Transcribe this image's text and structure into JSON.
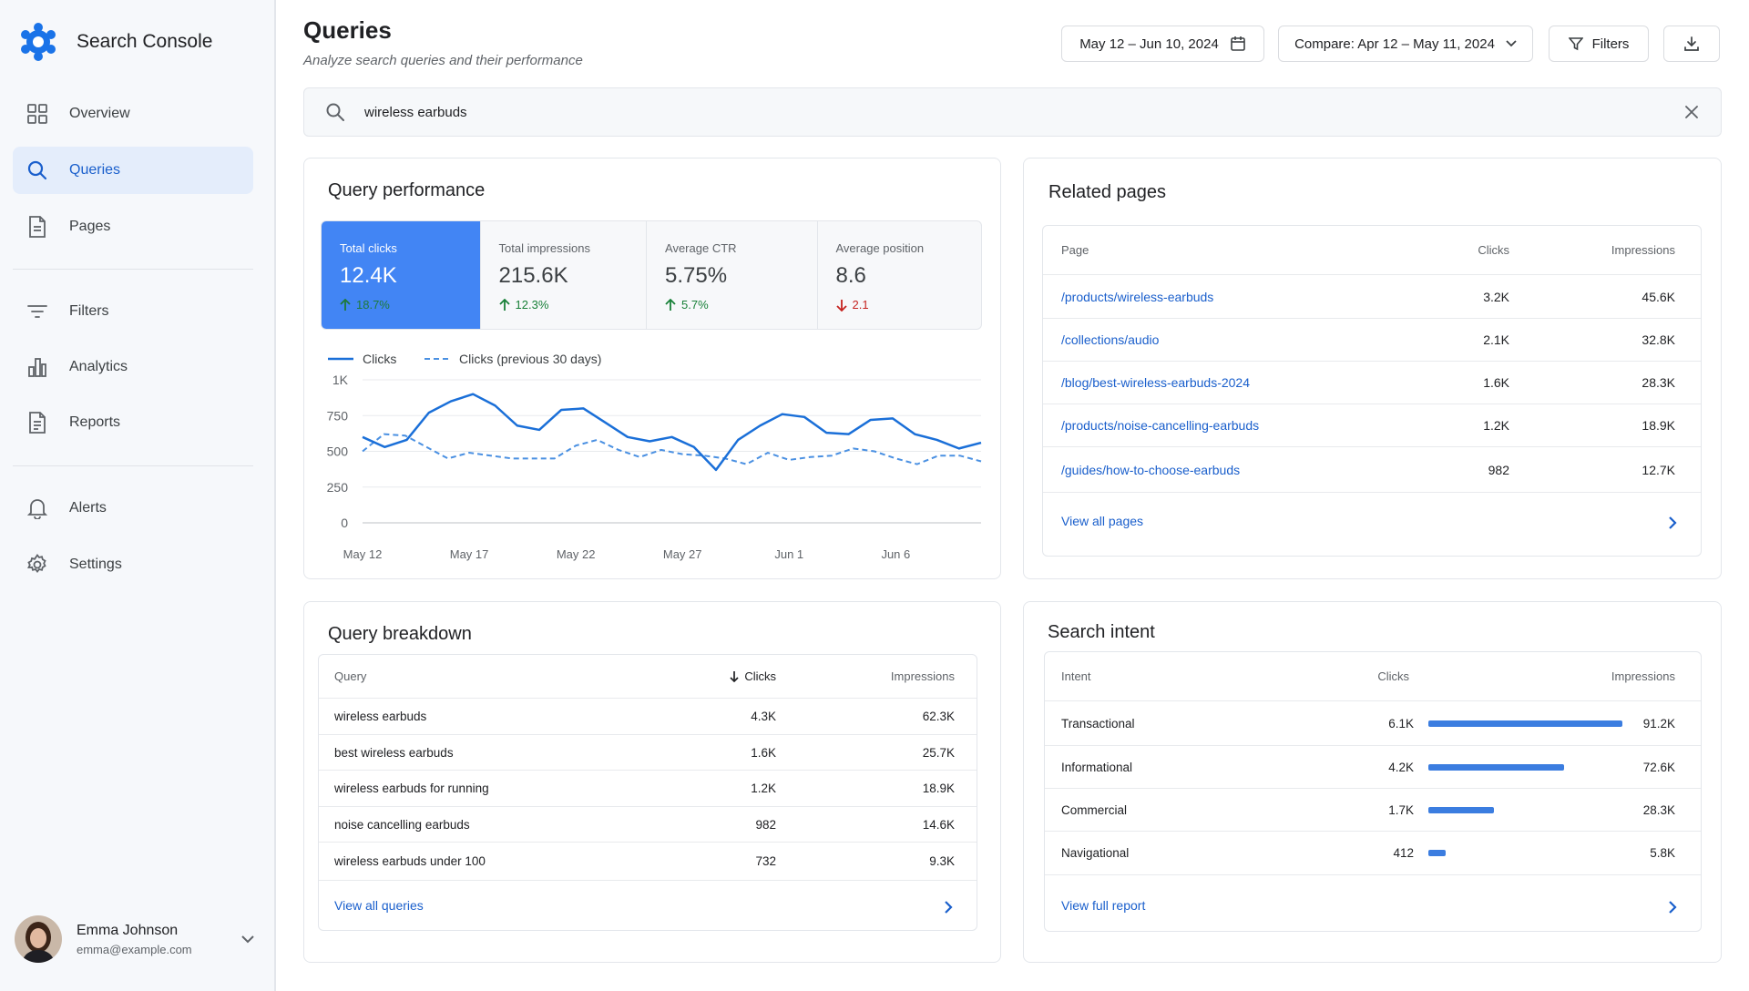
{
  "app": {
    "name": "Search Console"
  },
  "sidebar": {
    "items": [
      {
        "label": "Overview",
        "icon": "grid-icon"
      },
      {
        "label": "Queries",
        "icon": "search-icon",
        "active": true
      },
      {
        "label": "Pages",
        "icon": "document-icon"
      },
      {
        "label": "Filters",
        "icon": "filter-lines-icon"
      },
      {
        "label": "Analytics",
        "icon": "bar-chart-icon"
      },
      {
        "label": "Reports",
        "icon": "report-icon"
      },
      {
        "label": "Alerts",
        "icon": "bell-icon"
      },
      {
        "label": "Settings",
        "icon": "gear-icon"
      }
    ]
  },
  "user": {
    "name": "Emma Johnson",
    "email": "emma@example.com"
  },
  "header": {
    "title": "Queries",
    "subtitle": "Analyze search queries and their performance",
    "date_range": "May 12 – Jun 10, 2024",
    "compare": "Compare: Apr 12 – May 11, 2024",
    "filters_label": "Filters"
  },
  "search": {
    "value": "wireless earbuds"
  },
  "performance": {
    "title": "Query performance",
    "metrics": [
      {
        "label": "Total clicks",
        "value": "12.4K",
        "delta": "18.7%",
        "direction": "up",
        "active": true
      },
      {
        "label": "Total impressions",
        "value": "215.6K",
        "delta": "12.3%",
        "direction": "up"
      },
      {
        "label": "Average CTR",
        "value": "5.75%",
        "delta": "5.7%",
        "direction": "up"
      },
      {
        "label": "Average position",
        "value": "8.6",
        "delta": "2.1",
        "direction": "down"
      }
    ]
  },
  "chart_data": {
    "type": "line",
    "x": [
      "May 12",
      "May 13",
      "May 14",
      "May 15",
      "May 16",
      "May 17",
      "May 18",
      "May 19",
      "May 20",
      "May 21",
      "May 22",
      "May 23",
      "May 24",
      "May 25",
      "May 26",
      "May 27",
      "May 28",
      "May 29",
      "May 30",
      "May 31",
      "Jun 1",
      "Jun 2",
      "Jun 3",
      "Jun 4",
      "Jun 5",
      "Jun 6",
      "Jun 7",
      "Jun 8",
      "Jun 9",
      "Jun 10"
    ],
    "xticks": [
      "May 12",
      "May 17",
      "May 22",
      "May 27",
      "Jun 1",
      "Jun 6"
    ],
    "yticks": [
      "0",
      "250",
      "500",
      "750",
      "1K"
    ],
    "ylim": [
      0,
      1000
    ],
    "grid": true,
    "legend_position": "top-left",
    "colors": {
      "primary": "#1a6fd8",
      "previous": "#4a90e2"
    },
    "series": [
      {
        "name": "Clicks",
        "style": "solid",
        "values": [
          600,
          530,
          580,
          770,
          850,
          900,
          820,
          680,
          650,
          790,
          800,
          700,
          600,
          570,
          600,
          530,
          370,
          580,
          680,
          760,
          740,
          630,
          620,
          720,
          730,
          620,
          580,
          520,
          560
        ]
      },
      {
        "name": "Clicks (previous 30 days)",
        "style": "dashed",
        "values": [
          500,
          620,
          610,
          530,
          450,
          490,
          470,
          450,
          450,
          450,
          540,
          580,
          510,
          460,
          510,
          480,
          470,
          450,
          410,
          490,
          440,
          460,
          470,
          520,
          500,
          450,
          410,
          470,
          470,
          430
        ]
      }
    ]
  },
  "related_pages": {
    "title": "Related pages",
    "headers": {
      "page": "Page",
      "clicks": "Clicks",
      "impressions": "Impressions"
    },
    "rows": [
      {
        "page": "/products/wireless-earbuds",
        "clicks": "3.2K",
        "impressions": "45.6K"
      },
      {
        "page": "/collections/audio",
        "clicks": "2.1K",
        "impressions": "32.8K"
      },
      {
        "page": "/blog/best-wireless-earbuds-2024",
        "clicks": "1.6K",
        "impressions": "28.3K"
      },
      {
        "page": "/products/noise-cancelling-earbuds",
        "clicks": "1.2K",
        "impressions": "18.9K"
      },
      {
        "page": "/guides/how-to-choose-earbuds",
        "clicks": "982",
        "impressions": "12.7K"
      }
    ],
    "footer": "View all pages"
  },
  "breakdown": {
    "title": "Query breakdown",
    "headers": {
      "query": "Query",
      "clicks": "Clicks",
      "impressions": "Impressions"
    },
    "rows": [
      {
        "query": "wireless earbuds",
        "clicks": "4.3K",
        "impressions": "62.3K"
      },
      {
        "query": "best wireless earbuds",
        "clicks": "1.6K",
        "impressions": "25.7K"
      },
      {
        "query": "wireless earbuds for running",
        "clicks": "1.2K",
        "impressions": "18.9K"
      },
      {
        "query": "noise cancelling earbuds",
        "clicks": "982",
        "impressions": "14.6K"
      },
      {
        "query": "wireless earbuds under 100",
        "clicks": "732",
        "impressions": "9.3K"
      }
    ],
    "footer": "View all queries"
  },
  "intent": {
    "title": "Search intent",
    "headers": {
      "intent": "Intent",
      "clicks": "Clicks",
      "impressions": "Impressions"
    },
    "rows": [
      {
        "intent": "Transactional",
        "clicks": "6.1K",
        "share": 1.0,
        "impressions": "91.2K"
      },
      {
        "intent": "Informational",
        "clicks": "4.2K",
        "share": 0.7,
        "impressions": "72.6K"
      },
      {
        "intent": "Commercial",
        "clicks": "1.7K",
        "share": 0.34,
        "impressions": "28.3K"
      },
      {
        "intent": "Navigational",
        "clicks": "412",
        "share": 0.09,
        "impressions": "5.8K"
      }
    ],
    "footer": "View full report"
  }
}
